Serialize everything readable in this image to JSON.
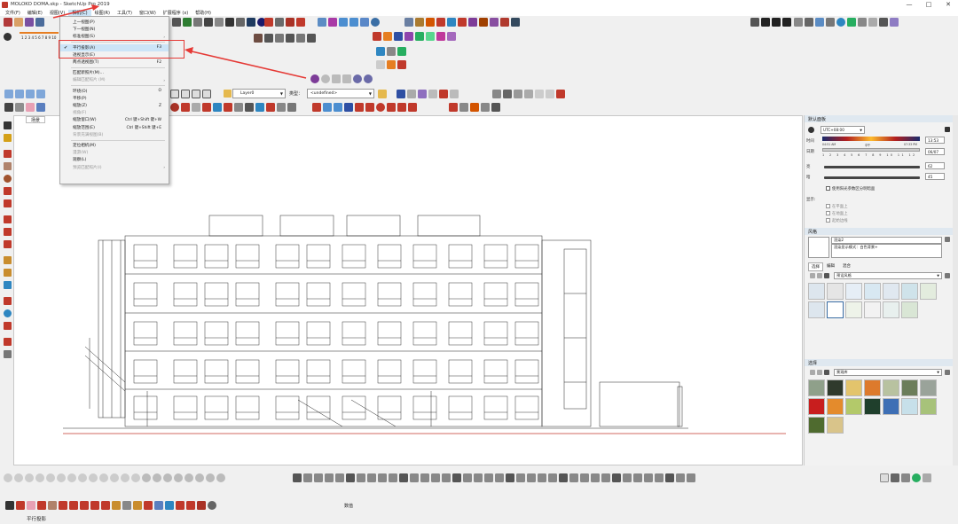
{
  "window": {
    "title": "MOLOKO DOMA.skp - SketchUp Pro 2019",
    "controls": [
      "—",
      "□",
      "✕"
    ]
  },
  "menubar": {
    "items": [
      "文件(F)",
      "编辑(E)",
      "视图(V)",
      "相机(C)",
      "绘图(R)",
      "工具(T)",
      "窗口(W)",
      "扩展程序 (x)",
      "帮助(H)"
    ],
    "active_index": 3
  },
  "camera_menu": {
    "items": [
      {
        "label": "上一视图(P)",
        "shortcut": "",
        "disabled": false
      },
      {
        "label": "下一视图(N)",
        "shortcut": "",
        "disabled": false
      },
      {
        "label": "标准视图(S)",
        "shortcut": "",
        "disabled": false,
        "submenu": true
      },
      {
        "label": "平行投影(A)",
        "shortcut": "F3",
        "disabled": false,
        "checked": true,
        "selected": true
      },
      {
        "label": "透视显示(E)",
        "shortcut": "",
        "disabled": false
      },
      {
        "label": "两点透视图(T)",
        "shortcut": "F2",
        "disabled": false
      },
      {
        "label": "匹配新照片(M)...",
        "shortcut": "",
        "disabled": false
      },
      {
        "label": "编辑匹配照片 (M)",
        "shortcut": "",
        "disabled": true,
        "submenu": true
      },
      {
        "label": "环绕(O)",
        "shortcut": "O",
        "disabled": false
      },
      {
        "label": "平移(P)",
        "shortcut": "",
        "disabled": false
      },
      {
        "label": "缩放(Z)",
        "shortcut": "Z",
        "disabled": false
      },
      {
        "label": "视角(F)",
        "shortcut": "",
        "disabled": true
      },
      {
        "label": "缩放窗口(W)",
        "shortcut": "Ctrl 键+Shift 键+W",
        "disabled": false
      },
      {
        "label": "缩放范围(E)",
        "shortcut": "Ctrl 键+Shift 键+E",
        "disabled": false
      },
      {
        "label": "背景充满视图(B)",
        "shortcut": "",
        "disabled": true
      },
      {
        "label": "定位相机(M)",
        "shortcut": "",
        "disabled": false
      },
      {
        "label": "漫游(W)",
        "shortcut": "",
        "disabled": true
      },
      {
        "label": "观察(L)",
        "shortcut": "",
        "disabled": false
      },
      {
        "label": "预览匹配照片(I)",
        "shortcut": "",
        "disabled": true,
        "submenu": true
      }
    ]
  },
  "toolbar": {
    "layer_select": "Layer0",
    "type_label": "类型：",
    "type_value": "<undefined>",
    "scale_numbers": "1 2 3 4 5 6 7 8 9 10"
  },
  "scene_tab": "场景",
  "shadows_panel": {
    "title": "默认面板",
    "timezone": "UTC+08:00",
    "time_label": "时间",
    "date_label": "日期",
    "time_start": "04:51 AM",
    "time_noon": "中午",
    "time_end": "07:33 PM",
    "time_value": "13:53",
    "months": "1 2 3 4 5 6 7 8 9 10 11 12",
    "date_value": "06/07",
    "light_label": "亮",
    "light_value": "62",
    "dark_label": "暗",
    "dark_value": "45",
    "use_sun_label": "使用阳光参数区分明暗面",
    "display_label": "显示:",
    "display_options": [
      "在平面上",
      "在地面上",
      "起始边线"
    ]
  },
  "styles_panel": {
    "title": "风格",
    "style_name": "渲染2",
    "style_desc": "渲染显示模式：白色背景+",
    "tabs": [
      "选择",
      "编辑",
      "混合"
    ],
    "collection": "预设风格"
  },
  "materials_panel": {
    "title": "选择",
    "collection": "景观库"
  },
  "status": {
    "text": "平行投影",
    "measure_label": "数值"
  },
  "colors": {
    "accent_red": "#e53935",
    "menu_highlight": "#cce4f7"
  }
}
